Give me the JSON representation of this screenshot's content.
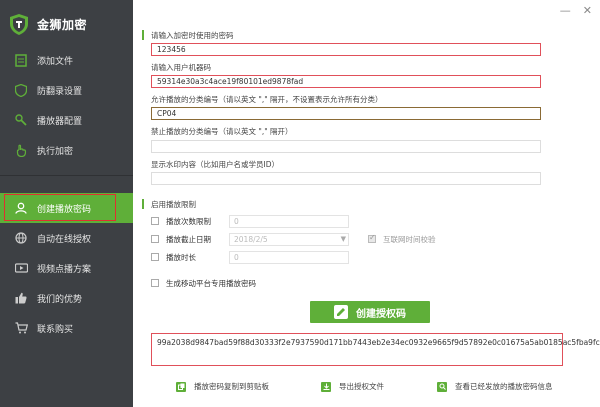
{
  "app": {
    "title": "金狮加密"
  },
  "window": {
    "minimize_icon": "minimize-icon",
    "close_icon": "close-icon"
  },
  "sidebar": {
    "items": [
      {
        "label": "添加文件",
        "icon": "file-icon"
      },
      {
        "label": "防翻录设置",
        "icon": "shield-icon"
      },
      {
        "label": "播放器配置",
        "icon": "wrench-icon"
      },
      {
        "label": "执行加密",
        "icon": "hand-icon"
      },
      {
        "label": "创建播放密码",
        "icon": "user-icon",
        "active": true
      },
      {
        "label": "自动在线授权",
        "icon": "globe-icon"
      },
      {
        "label": "视频点播方案",
        "icon": "video-icon"
      },
      {
        "label": "我们的优势",
        "icon": "thumbs-up-icon"
      },
      {
        "label": "联系购买",
        "icon": "cart-icon"
      }
    ]
  },
  "form": {
    "password_label": "请输入加密时使用的密码",
    "password_value": "123456",
    "machine_label": "请输入用户机器码",
    "machine_value": "59314e30a3c4ace19f80101ed9878fad",
    "allowed_label": "允许播放的分类编号（请以英文 \",\" 隔开，不设置表示允许所有分类）",
    "allowed_value": "CP04",
    "forbidden_label": "禁止播放的分类编号（请以英文 \",\" 隔开）",
    "forbidden_value": "",
    "watermark_label": "显示水印内容（比如用户名或学员ID）",
    "watermark_value": ""
  },
  "limits": {
    "section_title": "启用播放限制",
    "count_label": "播放次数限制",
    "count_value": "0",
    "date_label": "播放截止日期",
    "date_value": "2018/2/5",
    "online_check_label": "互联网时间校验",
    "duration_label": "播放时长",
    "duration_value": "0"
  },
  "mobile": {
    "label": "生成移动平台专用播放密码"
  },
  "create_button": {
    "label": "创建授权码"
  },
  "result": {
    "code": "99a2038d9847bad59f88d30333f2e7937590d171bb7443eb2e34ec0932e9665f9d57892e0c01675a5ab0185ac5fba9fc"
  },
  "bottom_links": [
    {
      "label": "播放密码复制到剪贴板",
      "icon": "copy-icon"
    },
    {
      "label": "导出授权文件",
      "icon": "export-icon"
    },
    {
      "label": "查看已经发放的播放密码信息",
      "icon": "search-icon"
    }
  ],
  "colors": {
    "accent": "#5faf39",
    "sidebar_bg": "#3d4044",
    "error_border": "#e0505a"
  }
}
